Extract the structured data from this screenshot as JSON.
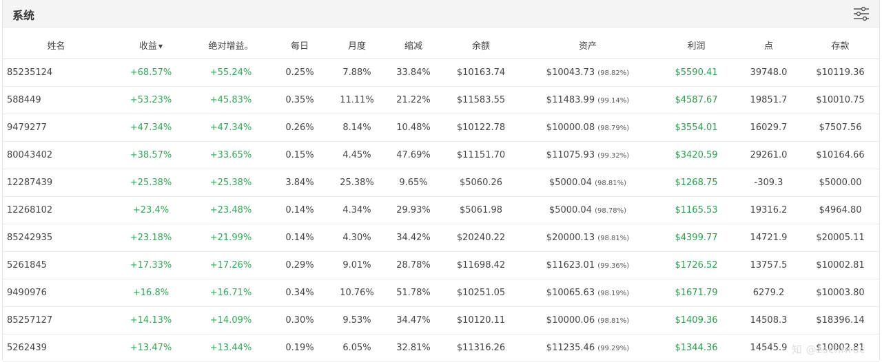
{
  "header": {
    "title": "系统",
    "filter_icon": "sliders-icon"
  },
  "columns": {
    "name": "姓名",
    "income": "收益",
    "income_sort_icon": "▼",
    "abs_gain": "绝对增益。",
    "daily": "每日",
    "monthly": "月度",
    "drawdown": "缩减",
    "balance": "余额",
    "equity": "资产",
    "profit": "利润",
    "points": "点",
    "deposit": "存款"
  },
  "rows": [
    {
      "name": "85235124",
      "income": "+68.57%",
      "abs_gain": "+55.24%",
      "daily": "0.25%",
      "monthly": "7.88%",
      "drawdown": "33.84%",
      "balance": "$10163.74",
      "equity": "$10043.73",
      "equity_pct": "(98.82%)",
      "profit": "$5590.41",
      "points": "39748.0",
      "deposit": "$10119.36"
    },
    {
      "name": "588449",
      "income": "+53.23%",
      "abs_gain": "+45.83%",
      "daily": "0.35%",
      "monthly": "11.11%",
      "drawdown": "21.22%",
      "balance": "$11583.55",
      "equity": "$11483.99",
      "equity_pct": "(99.14%)",
      "profit": "$4587.67",
      "points": "19851.7",
      "deposit": "$10010.75"
    },
    {
      "name": "9479277",
      "income": "+47.34%",
      "abs_gain": "+47.34%",
      "daily": "0.26%",
      "monthly": "8.14%",
      "drawdown": "10.48%",
      "balance": "$10122.78",
      "equity": "$10000.08",
      "equity_pct": "(98.79%)",
      "profit": "$3554.01",
      "points": "16029.7",
      "deposit": "$7507.56"
    },
    {
      "name": "80043402",
      "income": "+38.57%",
      "abs_gain": "+33.65%",
      "daily": "0.15%",
      "monthly": "4.45%",
      "drawdown": "47.69%",
      "balance": "$11151.70",
      "equity": "$11075.93",
      "equity_pct": "(99.32%)",
      "profit": "$3420.59",
      "points": "29261.0",
      "deposit": "$10164.66"
    },
    {
      "name": "12287439",
      "income": "+25.38%",
      "abs_gain": "+25.38%",
      "daily": "3.84%",
      "monthly": "25.38%",
      "drawdown": "9.65%",
      "balance": "$5060.26",
      "equity": "$5000.04",
      "equity_pct": "(98.81%)",
      "profit": "$1268.75",
      "points": "-309.3",
      "deposit": "$5000.00"
    },
    {
      "name": "12268102",
      "income": "+23.4%",
      "abs_gain": "+23.48%",
      "daily": "0.14%",
      "monthly": "4.34%",
      "drawdown": "29.93%",
      "balance": "$5061.98",
      "equity": "$5000.04",
      "equity_pct": "(98.78%)",
      "profit": "$1165.53",
      "points": "19316.2",
      "deposit": "$4964.80"
    },
    {
      "name": "85242935",
      "income": "+23.18%",
      "abs_gain": "+21.99%",
      "daily": "0.14%",
      "monthly": "4.30%",
      "drawdown": "34.42%",
      "balance": "$20240.22",
      "equity": "$20000.13",
      "equity_pct": "(98.81%)",
      "profit": "$4399.77",
      "points": "14721.9",
      "deposit": "$20005.11"
    },
    {
      "name": "5261845",
      "income": "+17.33%",
      "abs_gain": "+17.26%",
      "daily": "0.29%",
      "monthly": "9.01%",
      "drawdown": "28.78%",
      "balance": "$11698.42",
      "equity": "$11623.01",
      "equity_pct": "(99.36%)",
      "profit": "$1726.52",
      "points": "13757.5",
      "deposit": "$10002.81"
    },
    {
      "name": "9490976",
      "income": "+16.8%",
      "abs_gain": "+16.71%",
      "daily": "0.34%",
      "monthly": "10.76%",
      "drawdown": "51.78%",
      "balance": "$10251.05",
      "equity": "$10065.63",
      "equity_pct": "(98.19%)",
      "profit": "$1671.79",
      "points": "6279.2",
      "deposit": "$10003.80"
    },
    {
      "name": "85257127",
      "income": "+14.13%",
      "abs_gain": "+14.09%",
      "daily": "0.30%",
      "monthly": "9.53%",
      "drawdown": "34.47%",
      "balance": "$10120.11",
      "equity": "$10000.06",
      "equity_pct": "(98.81%)",
      "profit": "$1409.36",
      "points": "14508.3",
      "deposit": "$18396.14"
    },
    {
      "name": "5262439",
      "income": "+13.47%",
      "abs_gain": "+13.44%",
      "daily": "0.19%",
      "monthly": "6.05%",
      "drawdown": "32.81%",
      "balance": "$11316.26",
      "equity": "$11235.46",
      "equity_pct": "(99.29%)",
      "profit": "$1344.36",
      "points": "14545.9",
      "deposit": "$10002.81"
    }
  ],
  "watermark": "知 @zschnruc",
  "colors": {
    "positive": "#2eaa55",
    "profit": "#27a04a",
    "header_bg": "#f4f4f4"
  }
}
